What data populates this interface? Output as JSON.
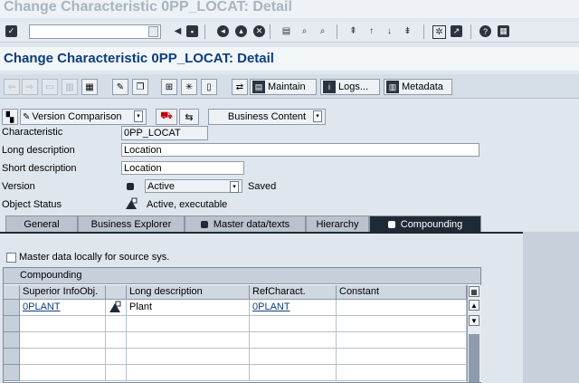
{
  "window": {
    "title": "Change Characteristic 0PP_LOCAT: Detail"
  },
  "screen": {
    "title": "Change Characteristic 0PP_LOCAT: Detail"
  },
  "command_field": {
    "value": ""
  },
  "app_toolbar": {
    "maintain_label": "Maintain",
    "logs_label": "Logs...",
    "metadata_label": "Metadata"
  },
  "toolbar2": {
    "version_comparison_label": "Version Comparison",
    "business_content_label": "Business Content"
  },
  "form": {
    "characteristic_label": "Characteristic",
    "characteristic_value": "0PP_LOCAT",
    "long_desc_label": "Long description",
    "long_desc_value": "Location",
    "short_desc_label": "Short description",
    "short_desc_value": "Location",
    "version_label": "Version",
    "version_value": "Active",
    "version_status": "Saved",
    "object_status_label": "Object Status",
    "object_status_value": "Active, executable"
  },
  "tabs": [
    {
      "label": "General"
    },
    {
      "label": "Business Explorer"
    },
    {
      "label": "Master data/texts"
    },
    {
      "label": "Hierarchy"
    },
    {
      "label": "Compounding"
    }
  ],
  "compounding": {
    "master_data_checkbox_label": "Master data locally for source sys.",
    "master_data_checked": false,
    "table_title": "Compounding",
    "columns": [
      "Superior InfoObj.",
      "Long description",
      "RefCharact.",
      "Constant"
    ],
    "rows": [
      {
        "superior": "0PLANT",
        "long_desc": "Plant",
        "ref": "0PLANT",
        "constant": ""
      }
    ]
  }
}
